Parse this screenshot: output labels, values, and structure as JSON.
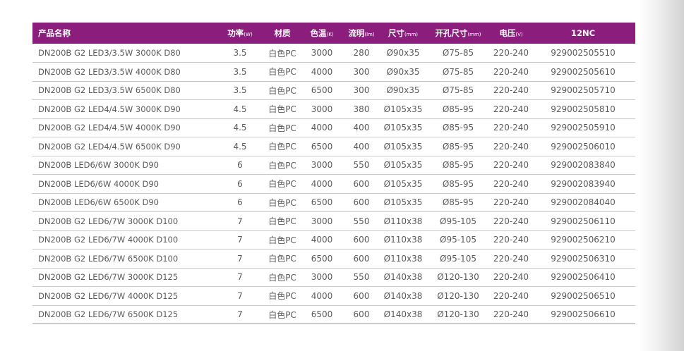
{
  "table": {
    "headers": [
      {
        "label": "产品名称",
        "unit": ""
      },
      {
        "label": "功率",
        "unit": "(W)"
      },
      {
        "label": "材质",
        "unit": ""
      },
      {
        "label": "色温",
        "unit": "(K)"
      },
      {
        "label": "流明",
        "unit": "(lm)"
      },
      {
        "label": "尺寸",
        "unit": "(mm)"
      },
      {
        "label": "开孔尺寸",
        "unit": "(mm)"
      },
      {
        "label": "电压",
        "unit": "(V)"
      },
      {
        "label": "12NC",
        "unit": ""
      }
    ],
    "rows": [
      [
        "DN200B G2 LED3/3.5W 3000K D80",
        "3.5",
        "白色PC",
        "3000",
        "280",
        "Ø90x35",
        "Ø75-85",
        "220-240",
        "929002505510"
      ],
      [
        "DN200B G2 LED3/3.5W 4000K D80",
        "3.5",
        "白色PC",
        "4000",
        "300",
        "Ø90x35",
        "Ø75-85",
        "220-240",
        "929002505610"
      ],
      [
        "DN200B G2 LED3/3.5W 6500K D80",
        "3.5",
        "白色PC",
        "6500",
        "300",
        "Ø90x35",
        "Ø75-85",
        "220-240",
        "929002505710"
      ],
      [
        "DN200B G2 LED4/4.5W 3000K D90",
        "4.5",
        "白色PC",
        "3000",
        "380",
        "Ø105x35",
        "Ø85-95",
        "220-240",
        "929002505810"
      ],
      [
        "DN200B G2 LED4/4.5W 4000K D90",
        "4.5",
        "白色PC",
        "4000",
        "400",
        "Ø105x35",
        "Ø85-95",
        "220-240",
        "929002505910"
      ],
      [
        "DN200B G2 LED4/4.5W 6500K D90",
        "4.5",
        "白色PC",
        "6500",
        "400",
        "Ø105x35",
        "Ø85-95",
        "220-240",
        "929002506010"
      ],
      [
        "DN200B LED6/6W 3000K D90",
        "6",
        "白色PC",
        "3000",
        "550",
        "Ø105x35",
        "Ø85-95",
        "220-240",
        "929002083840"
      ],
      [
        "DN200B LED6/6W 4000K D90",
        "6",
        "白色PC",
        "4000",
        "600",
        "Ø105x35",
        "Ø85-95",
        "220-240",
        "929002083940"
      ],
      [
        "DN200B LED6/6W 6500K D90",
        "6",
        "白色PC",
        "6500",
        "600",
        "Ø105x35",
        "Ø85-95",
        "220-240",
        "929002084040"
      ],
      [
        "DN200B G2 LED6/7W 3000K D100",
        "7",
        "白色PC",
        "3000",
        "550",
        "Ø110x38",
        "Ø95-105",
        "220-240",
        "929002506110"
      ],
      [
        "DN200B G2 LED6/7W 4000K D100",
        "7",
        "白色PC",
        "4000",
        "600",
        "Ø110x38",
        "Ø95-105",
        "220-240",
        "929002506210"
      ],
      [
        "DN200B G2 LED6/7W 6500K D100",
        "7",
        "白色PC",
        "6500",
        "600",
        "Ø110x38",
        "Ø95-105",
        "220-240",
        "929002506310"
      ],
      [
        "DN200B G2 LED6/7W 3000K D125",
        "7",
        "白色PC",
        "3000",
        "550",
        "Ø140x38",
        "Ø120-130",
        "220-240",
        "929002506410"
      ],
      [
        "DN200B G2 LED6/7W 4000K D125",
        "7",
        "白色PC",
        "4000",
        "600",
        "Ø140x38",
        "Ø120-130",
        "220-240",
        "929002506510"
      ],
      [
        "DN200B G2 LED6/7W 6500K D125",
        "7",
        "白色PC",
        "6500",
        "600",
        "Ø140x38",
        "Ø120-130",
        "220-240",
        "929002506610"
      ]
    ]
  },
  "colors": {
    "header_bg": "#8b1e7d",
    "header_text": "#ffffff",
    "body_text": "#5b5b5b",
    "row_divider": "#c9c9c9"
  }
}
